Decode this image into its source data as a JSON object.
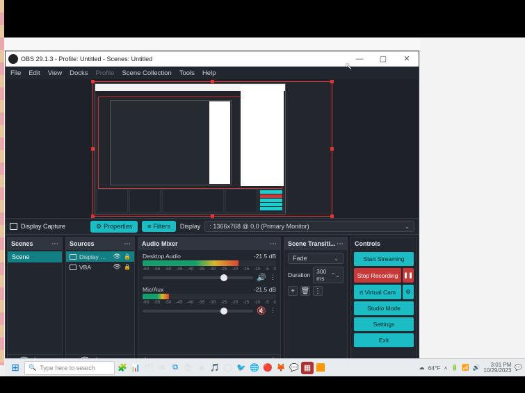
{
  "window_title": "OBS 29.1.3 - Profile: Untitled - Scenes: Untitled",
  "menu": {
    "file": "File",
    "edit": "Edit",
    "view": "View",
    "docks": "Docks",
    "profile": "Profile",
    "scene_collection": "Scene Collection",
    "tools": "Tools",
    "help": "Help"
  },
  "capture": {
    "label": "Display Capture",
    "properties": "Properties",
    "filters": "Filters",
    "display_label": "Display",
    "display_value": ": 1366x768 @ 0,0 (Primary Monitor)"
  },
  "panels": {
    "scenes": {
      "title": "Scenes",
      "items": [
        "Scene"
      ]
    },
    "sources": {
      "title": "Sources",
      "items": [
        {
          "name": "Display Captu",
          "selected": true
        },
        {
          "name": "VBA",
          "selected": false
        }
      ]
    },
    "mixer": {
      "title": "Audio Mixer",
      "channels": [
        {
          "name": "Desktop Audio",
          "db": "-21.5 dB",
          "muted": false
        },
        {
          "name": "Mic/Aux",
          "db": "-21.5 dB",
          "muted": true
        }
      ],
      "ticks": [
        "-60",
        "-55",
        "-50",
        "-45",
        "-40",
        "-35",
        "-30",
        "-25",
        "-20",
        "-15",
        "-10",
        "-5",
        "0"
      ]
    },
    "transitions": {
      "title": "Scene Transiti...",
      "mode": "Fade",
      "duration_label": "Duration",
      "duration": "300 ms"
    },
    "controls": {
      "title": "Controls",
      "start_streaming": "Start Streaming",
      "stop_recording": "Stop Recording",
      "virtual_cam": "rt Virtual Cam",
      "studio_mode": "Studio Mode",
      "settings": "Settings",
      "exit": "Exit"
    }
  },
  "taskbar": {
    "search_placeholder": "Type here to search",
    "weather": "64°F",
    "time": "3:01 PM",
    "date": "10/29/2023"
  }
}
